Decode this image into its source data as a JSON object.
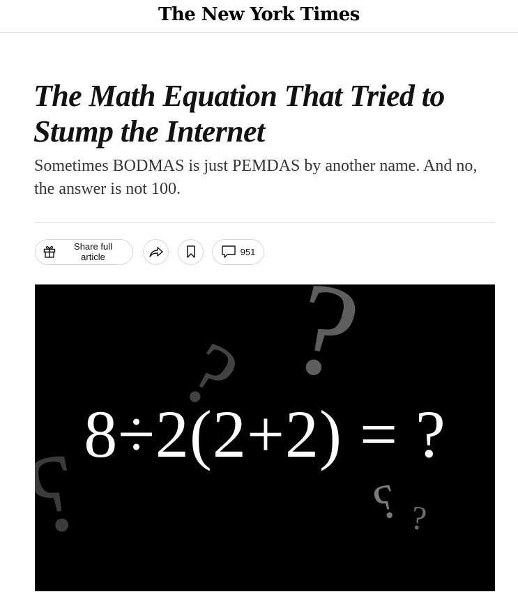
{
  "masthead": {
    "logo_text": "The New York Times"
  },
  "article": {
    "headline": "The Math Equation That Tried to Stump the Internet",
    "summary": "Sometimes BODMAS is just PEMDAS by another name. And no, the answer is not 100."
  },
  "toolbar": {
    "share_full_label": "Share full article",
    "share_icon": "share-arrow-icon",
    "save_icon": "bookmark-icon",
    "comments_count": "951",
    "comments_icon": "comment-bubble-icon"
  },
  "hero_image": {
    "equation_text": "8÷2(2+2) = ?",
    "decorations": [
      "?",
      "?",
      "?",
      "?",
      "?"
    ]
  }
}
